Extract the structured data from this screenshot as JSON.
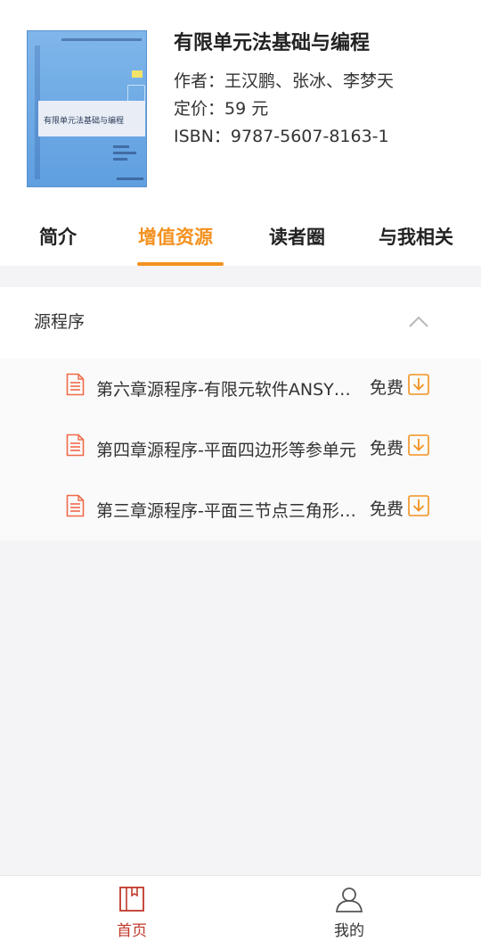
{
  "book": {
    "title": "有限单元法基础与编程",
    "author": "作者：王汉鹏、张冰、李梦天",
    "price": "定价：59 元",
    "isbn": "ISBN：9787-5607-8163-1",
    "cover_title": "有限单元法基础与编程"
  },
  "tabs": [
    {
      "label": "简介",
      "active": false
    },
    {
      "label": "增值资源",
      "active": true
    },
    {
      "label": "读者圈",
      "active": false
    },
    {
      "label": "与我相关",
      "active": false
    }
  ],
  "section": {
    "title": "源程序",
    "expanded": true,
    "icon": "chevron-up-icon"
  },
  "files": [
    {
      "name": "第六章源程序-有限元软件ANSYS应用",
      "price_label": "免费",
      "icon": "document-icon",
      "action_icon": "download-icon"
    },
    {
      "name": "第四章源程序-平面四边形等参单元",
      "price_label": "免费",
      "icon": "document-icon",
      "action_icon": "download-icon"
    },
    {
      "name": "第三章源程序-平面三节点三角形单元",
      "price_label": "免费",
      "icon": "document-icon",
      "action_icon": "download-icon"
    }
  ],
  "bottom_nav": [
    {
      "label": "首页",
      "icon": "book-icon",
      "active": true
    },
    {
      "label": "我的",
      "icon": "user-icon",
      "active": false
    }
  ],
  "colors": {
    "accent": "#f3911f",
    "active_nav": "#c0392b",
    "doc_icon": "#f06a4a"
  }
}
